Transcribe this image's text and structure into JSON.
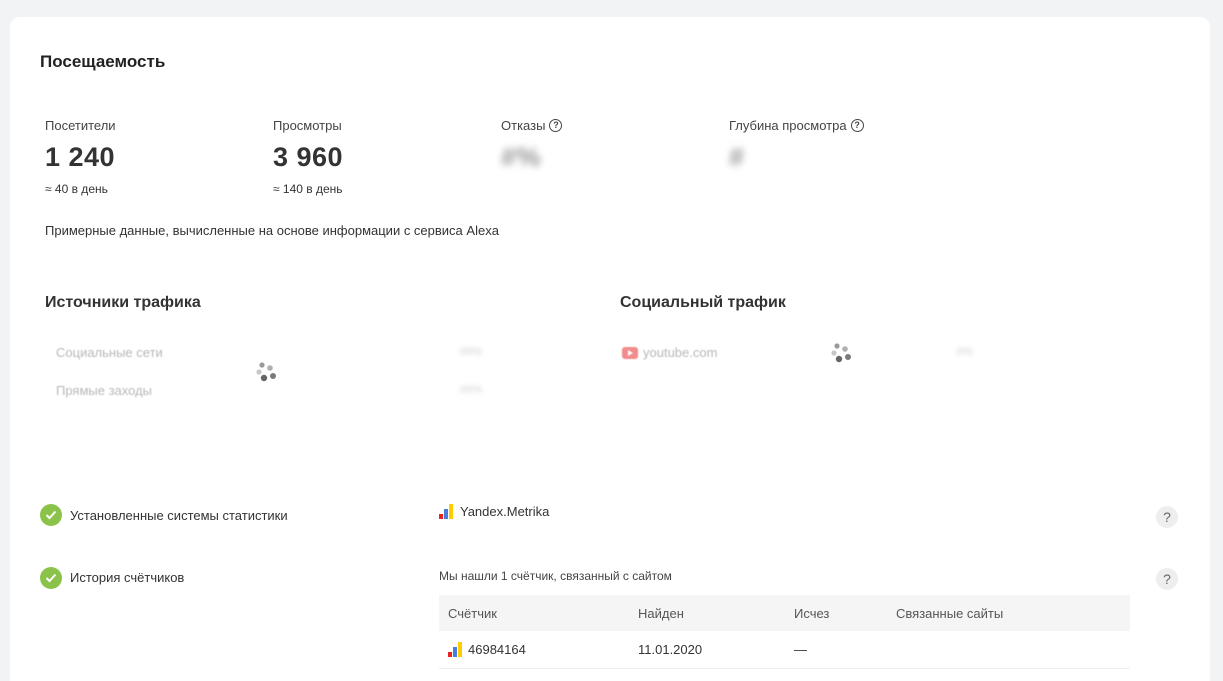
{
  "section_title": "Посещаемость",
  "metrics": [
    {
      "label": "Посетители",
      "value": "1 240",
      "sub": "≈ 40 в день"
    },
    {
      "label": "Просмотры",
      "value": "3 960",
      "sub": "≈ 140 в день"
    },
    {
      "label": "Отказы",
      "value": "#%",
      "help": "?"
    },
    {
      "label": "Глубина просмотра",
      "value": "#",
      "help": "?"
    }
  ],
  "note": "Примерные данные, вычисленные на основе информации с сервиса Alexa",
  "traffic_sources": {
    "title": "Источники трафика",
    "items": [
      {
        "label": "Социальные сети",
        "value": "##%"
      },
      {
        "label": "Прямые заходы",
        "value": "##%"
      }
    ]
  },
  "social_traffic": {
    "title": "Социальный трафик",
    "items": [
      {
        "label": "youtube.com",
        "value": "#%"
      }
    ]
  },
  "stats_systems": {
    "label": "Установленные системы статистики",
    "value": "Yandex.Metrika",
    "help": "?"
  },
  "counter_history": {
    "label": "История счётчиков",
    "summary": "Мы нашли 1 счётчик, связанный с сайтом",
    "help": "?",
    "columns": [
      "Счётчик",
      "Найден",
      "Исчез",
      "Связанные сайты"
    ],
    "rows": [
      {
        "counter": "46984164",
        "found": "11.01.2020",
        "gone": "—",
        "related": ""
      }
    ]
  },
  "colors": {
    "check_green": "#8bc34a",
    "youtube_red": "#e53935",
    "metrika_red": "#e52620",
    "metrika_blue": "#4a7ddb",
    "metrika_yellow": "#ffcc00"
  }
}
